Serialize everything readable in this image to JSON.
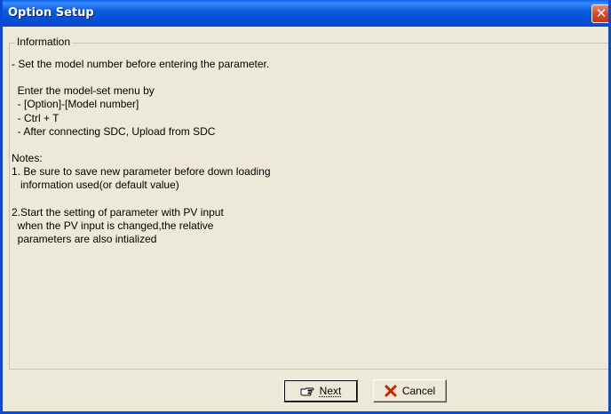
{
  "window": {
    "title": "Option Setup"
  },
  "titlebar_buttons": {
    "close_glyph": "✕"
  },
  "groupbox": {
    "legend": "Information"
  },
  "info_lines": [
    "- Set the model number before entering the parameter.",
    "",
    "  Enter the model-set menu by",
    "  - [Option]-[Model number]",
    "  - Ctrl + T",
    "  - After connecting SDC, Upload from SDC",
    "",
    "Notes:",
    "1. Be sure to save new parameter before down loading",
    "   information used(or default value)",
    "",
    "2.Start the setting of parameter with PV input",
    "  when the PV input is changed,the relative",
    "  parameters are also intialized"
  ],
  "buttons": {
    "next_label": "Next",
    "next_icon": "pointing-hand-icon",
    "cancel_label": "Cancel",
    "cancel_icon": "red-x-icon"
  },
  "colors": {
    "titlebar": "#0551d6",
    "window_bg": "#ece9d8",
    "close_button": "#d64a2a",
    "cancel_icon": "#cc2200"
  }
}
